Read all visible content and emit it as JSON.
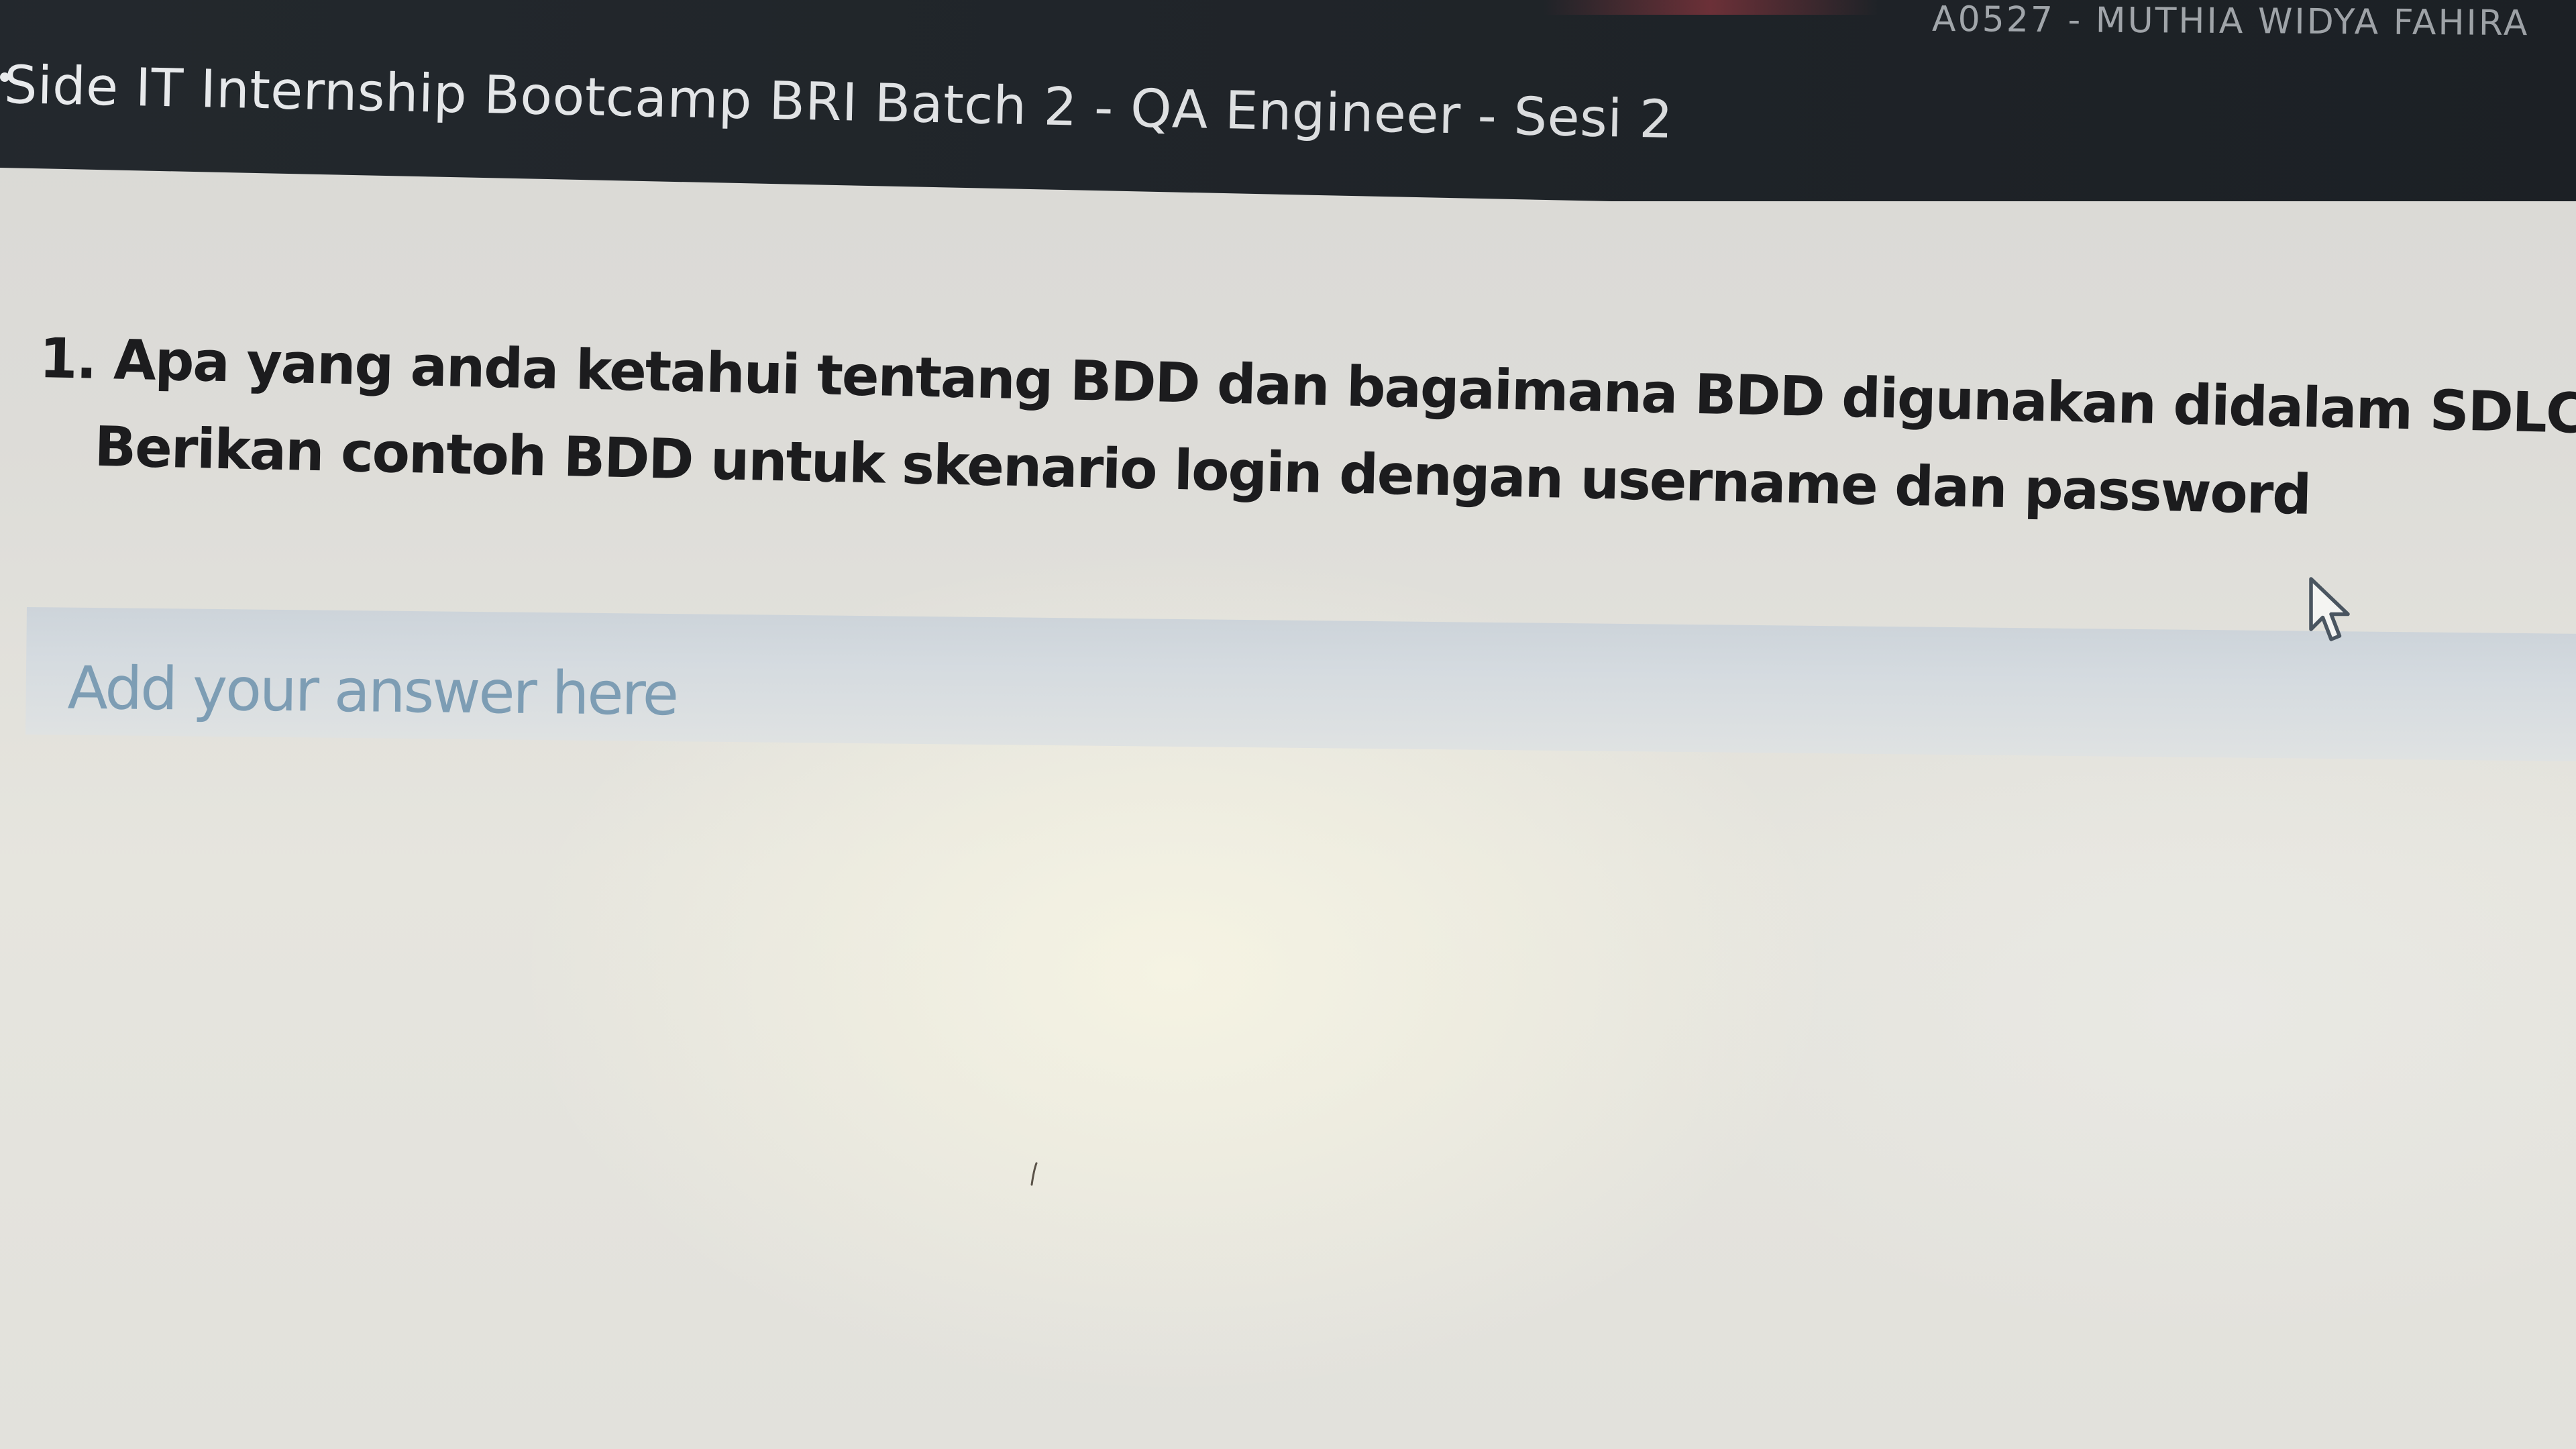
{
  "header": {
    "user_label": "A0527 - MUTHIA WIDYA FAHIRA",
    "title": "Side IT Internship Bootcamp BRI Batch 2 - QA Engineer - Sesi 2"
  },
  "question": {
    "number": "1.",
    "line1": "Apa yang anda ketahui tentang BDD dan bagaimana BDD digunakan didalam SDLC?",
    "line2": "Berikan contoh BDD untuk skenario login dengan username dan password"
  },
  "answer": {
    "placeholder": "Add your answer here",
    "value": ""
  },
  "colors": {
    "header_bg": "#1f2429",
    "page_bg": "#e2e1dc",
    "question_text": "#1c1c1e",
    "placeholder_text": "#7d9db4"
  },
  "icons": {
    "cursor": "mouse-pointer-icon"
  }
}
